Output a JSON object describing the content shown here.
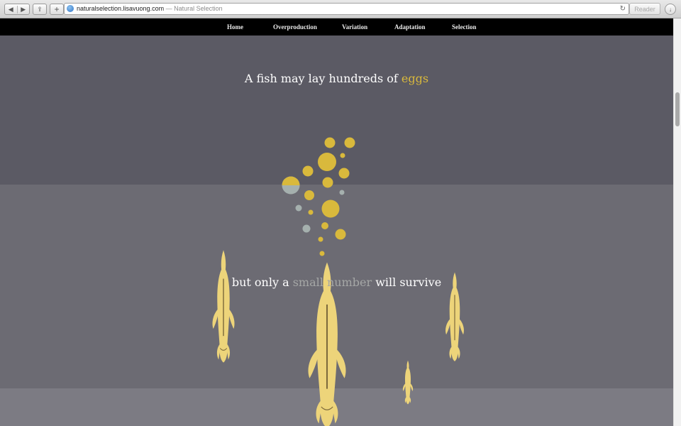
{
  "browser": {
    "url": "naturalselection.lisavuong.com",
    "separator": "—",
    "page_title": "Natural Selection",
    "reader_label": "Reader",
    "back_glyph": "◀",
    "forward_glyph": "▶",
    "plus_glyph": "+",
    "share_glyph": "⇪",
    "reload_glyph": "↻",
    "downloads_glyph": "↓"
  },
  "nav": {
    "items": [
      {
        "label": "Home"
      },
      {
        "label": "Overproduction"
      },
      {
        "label": "Variation"
      },
      {
        "label": "Adaptation"
      },
      {
        "label": "Selection"
      }
    ]
  },
  "content": {
    "line1": {
      "before": "A fish may lay hundreds of ",
      "highlight": "eggs"
    },
    "line2": {
      "before": "but only a ",
      "highlight": "small number",
      "after": " will survive"
    }
  },
  "colors": {
    "egg_gold": "#d9b93c",
    "egg_grey": "#a5b0ae",
    "fish": "#edd47a",
    "fish_line": "#7d6a3c",
    "nav_bg": "#000000",
    "band_dark": "#5b5a64",
    "band_mid": "#6c6b73",
    "band_light": "#7c7b83"
  }
}
